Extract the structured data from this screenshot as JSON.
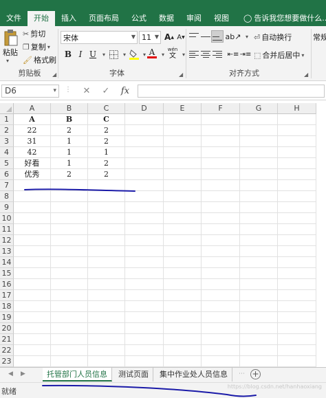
{
  "ribbon_tabs": [
    {
      "label": "文件"
    },
    {
      "label": "开始"
    },
    {
      "label": "插入"
    },
    {
      "label": "页面布局"
    },
    {
      "label": "公式"
    },
    {
      "label": "数据"
    },
    {
      "label": "审阅"
    },
    {
      "label": "视图"
    }
  ],
  "tell_me": "告诉我您想要做什么...",
  "clipboard": {
    "paste": "粘贴",
    "cut": "剪切",
    "copy": "复制",
    "format_painter": "格式刷",
    "group_label": "剪贴板"
  },
  "font": {
    "name": "宋体",
    "size": "11",
    "group_label": "字体",
    "bold": "B",
    "italic": "I",
    "underline": "U",
    "grow": "A",
    "shrink": "A",
    "font_color_letter": "A",
    "wen": "wén",
    "wen_char": "文"
  },
  "alignment": {
    "wrap_text": "自动换行",
    "merge_center": "合并后居中",
    "group_label": "对齐方式",
    "overflow": "常规"
  },
  "formula_bar": {
    "name_box": "D6",
    "cancel": "✕",
    "enter": "✓",
    "fx": "fx",
    "formula": ""
  },
  "columns": [
    "A",
    "B",
    "C",
    "D",
    "E",
    "F",
    "G",
    "H"
  ],
  "rows": [
    "1",
    "2",
    "3",
    "4",
    "5",
    "6",
    "7",
    "8",
    "9",
    "10",
    "11",
    "12",
    "13",
    "14",
    "15",
    "16",
    "17",
    "18",
    "19",
    "20",
    "21",
    "22",
    "23"
  ],
  "cells": [
    [
      "A",
      "B",
      "C"
    ],
    [
      "22",
      "2",
      "2"
    ],
    [
      "31",
      "1",
      "2"
    ],
    [
      "42",
      "1",
      "1"
    ],
    [
      "好看",
      "1",
      "2"
    ],
    [
      "优秀",
      "2",
      "2"
    ]
  ],
  "sheet_tabs": [
    {
      "label": "托管部门人员信息",
      "active": true
    },
    {
      "label": "测试页面",
      "active": false
    },
    {
      "label": "集中作业处人员信息",
      "active": false
    }
  ],
  "status": "就绪",
  "watermark": "https://blog.csdn.net/hanhaoxiang",
  "colors": {
    "accent": "#217346",
    "annotation": "#1a1aa8"
  }
}
